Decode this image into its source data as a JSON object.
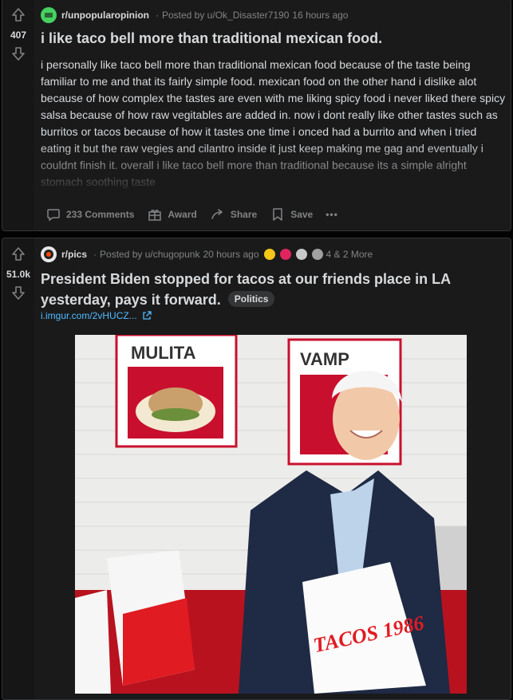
{
  "post1": {
    "subreddit": "r/unpopularopinion",
    "posted_by": "Posted by u/Ok_Disaster7190",
    "time": "16 hours ago",
    "votes": "407",
    "title": "i like taco bell more than traditional mexican food.",
    "body": "i personally like taco bell more than traditional mexican food because of the taste being familiar to me and that its fairly simple food. mexican food on the other hand i dislike alot because of how complex the tastes are even with me liking spicy food i never liked there spicy salsa because of how raw vegitables are added in. now i dont really like other tastes such as burritos or tacos because of how it tastes one time i onced had a burrito and when i tried eating it but the raw vegies and cilantro inside it just keep making me gag and eventually i couldnt finish it. overall i like taco bell more than traditional because its a simple alright stomach soothing taste",
    "comments": "233 Comments",
    "award": "Award",
    "share": "Share",
    "save": "Save",
    "more": "•••",
    "icon_color": "#46d160"
  },
  "post2": {
    "subreddit": "r/pics",
    "posted_by": "Posted by u/chugopunk",
    "time": "20 hours ago",
    "awards_more": "4 & 2 More",
    "votes": "51.0k",
    "title": "President Biden stopped for tacos at our friends place in LA yesterday, pays it forward.",
    "flair": "Politics",
    "link": "i.imgur.com/2vHUCZ...",
    "image_sign_left": "MULITA",
    "image_sign_right": "VAMP",
    "image_bag_text": "TACOS 1986"
  },
  "colors": {
    "bg": "#030303",
    "card": "#1a1a1b",
    "text": "#d7dadc",
    "muted": "#818384",
    "link": "#4fbcff"
  }
}
